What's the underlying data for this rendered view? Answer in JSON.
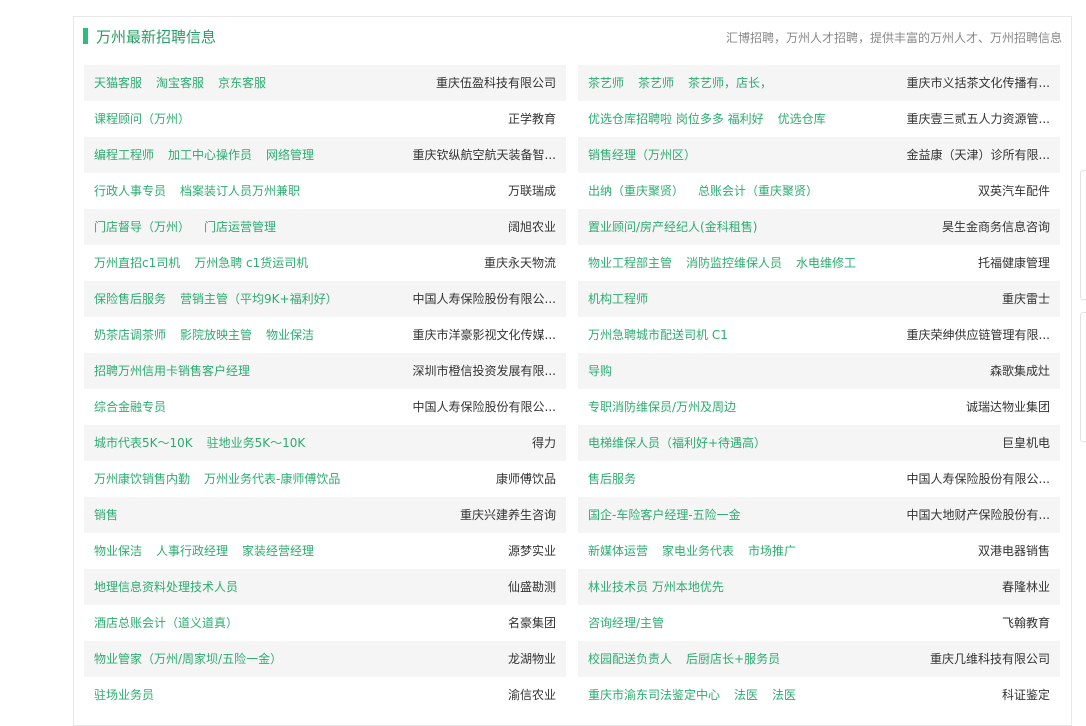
{
  "section": {
    "title": "万州最新招聘信息",
    "description": "汇博招聘，万州人才招聘，提供丰富的万州人才、万州招聘信息"
  },
  "rows": [
    {
      "left": {
        "jobs": [
          "天猫客服",
          "淘宝客服",
          "京东客服"
        ],
        "company": "重庆伍盈科技有限公司"
      },
      "right": {
        "jobs": [
          "茶艺师",
          "茶艺师",
          "茶艺师，店长，"
        ],
        "company": "重庆市义括茶文化传播有..."
      }
    },
    {
      "left": {
        "jobs": [
          "课程顾问（万州）"
        ],
        "company": "正学教育"
      },
      "right": {
        "jobs": [
          "优选仓库招聘啦 岗位多多 福利好",
          "优选仓库"
        ],
        "company": "重庆壹三贰五人力资源管..."
      }
    },
    {
      "left": {
        "jobs": [
          "编程工程师",
          "加工中心操作员",
          "网络管理"
        ],
        "company": "重庆钦纵航空航天装备智..."
      },
      "right": {
        "jobs": [
          "销售经理（万州区）"
        ],
        "company": "金益康（天津）诊所有限..."
      }
    },
    {
      "left": {
        "jobs": [
          "行政人事专员",
          "档案装订人员万州兼职"
        ],
        "company": "万联瑞成"
      },
      "right": {
        "jobs": [
          "出纳（重庆聚贤）",
          "总账会计（重庆聚贤）"
        ],
        "company": "双英汽车配件"
      }
    },
    {
      "left": {
        "jobs": [
          "门店督导（万州）",
          "门店运营管理"
        ],
        "company": "阔旭农业"
      },
      "right": {
        "jobs": [
          "置业顾问/房产经纪人(金科租售)"
        ],
        "company": "昊生金商务信息咨询"
      }
    },
    {
      "left": {
        "jobs": [
          "万州直招c1司机",
          "万州急聘 c1货运司机"
        ],
        "company": "重庆永天物流"
      },
      "right": {
        "jobs": [
          "物业工程部主管",
          "消防监控维保人员",
          "水电维修工"
        ],
        "company": "托福健康管理"
      }
    },
    {
      "left": {
        "jobs": [
          "保险售后服务",
          "营销主管（平均9K+福利好）"
        ],
        "company": "中国人寿保险股份有限公..."
      },
      "right": {
        "jobs": [
          "机构工程师"
        ],
        "company": "重庆雷士"
      }
    },
    {
      "left": {
        "jobs": [
          "奶茶店调茶师",
          "影院放映主管",
          "物业保洁"
        ],
        "company": "重庆市洋豪影视文化传媒..."
      },
      "right": {
        "jobs": [
          "万州急聘城市配送司机 C1"
        ],
        "company": "重庆荣绅供应链管理有限..."
      }
    },
    {
      "left": {
        "jobs": [
          "招聘万州信用卡销售客户经理"
        ],
        "company": "深圳市橙信投资发展有限..."
      },
      "right": {
        "jobs": [
          "导购"
        ],
        "company": "森歌集成灶"
      }
    },
    {
      "left": {
        "jobs": [
          "综合金融专员"
        ],
        "company": "中国人寿保险股份有限公..."
      },
      "right": {
        "jobs": [
          "专职消防维保员/万州及周边"
        ],
        "company": "诚瑞达物业集团"
      }
    },
    {
      "left": {
        "jobs": [
          "城市代表5K～10K",
          "驻地业务5K～10K"
        ],
        "company": "得力"
      },
      "right": {
        "jobs": [
          "电梯维保人员（福利好+待遇高）"
        ],
        "company": "巨皇机电"
      }
    },
    {
      "left": {
        "jobs": [
          "万州康饮销售内勤",
          "万州业务代表-康师傅饮品"
        ],
        "company": "康师傅饮品"
      },
      "right": {
        "jobs": [
          "售后服务"
        ],
        "company": "中国人寿保险股份有限公..."
      }
    },
    {
      "left": {
        "jobs": [
          "销售"
        ],
        "company": "重庆兴建养生咨询"
      },
      "right": {
        "jobs": [
          "国企-车险客户经理-五险一金"
        ],
        "company": "中国大地财产保险股份有..."
      }
    },
    {
      "left": {
        "jobs": [
          "物业保洁",
          "人事行政经理",
          "家装经营经理"
        ],
        "company": "源梦实业"
      },
      "right": {
        "jobs": [
          "新媒体运营",
          "家电业务代表",
          "市场推广"
        ],
        "company": "双港电器销售"
      }
    },
    {
      "left": {
        "jobs": [
          "地理信息资料处理技术人员"
        ],
        "company": "仙盛勘测"
      },
      "right": {
        "jobs": [
          "林业技术员 万州本地优先"
        ],
        "company": "春隆林业"
      }
    },
    {
      "left": {
        "jobs": [
          "酒店总账会计（道义道真）"
        ],
        "company": "名豪集团"
      },
      "right": {
        "jobs": [
          "咨询经理/主管"
        ],
        "company": "飞翰教育"
      }
    },
    {
      "left": {
        "jobs": [
          "物业管家（万州/周家坝/五险一金）"
        ],
        "company": "龙湖物业"
      },
      "right": {
        "jobs": [
          "校园配送负责人",
          "后厨店长+服务员"
        ],
        "company": "重庆几维科技有限公司"
      }
    },
    {
      "left": {
        "jobs": [
          "驻场业务员"
        ],
        "company": "渝信农业"
      },
      "right": {
        "jobs": [
          "重庆市渝东司法鉴定中心",
          "法医",
          "法医"
        ],
        "company": "科证鉴定"
      }
    }
  ]
}
